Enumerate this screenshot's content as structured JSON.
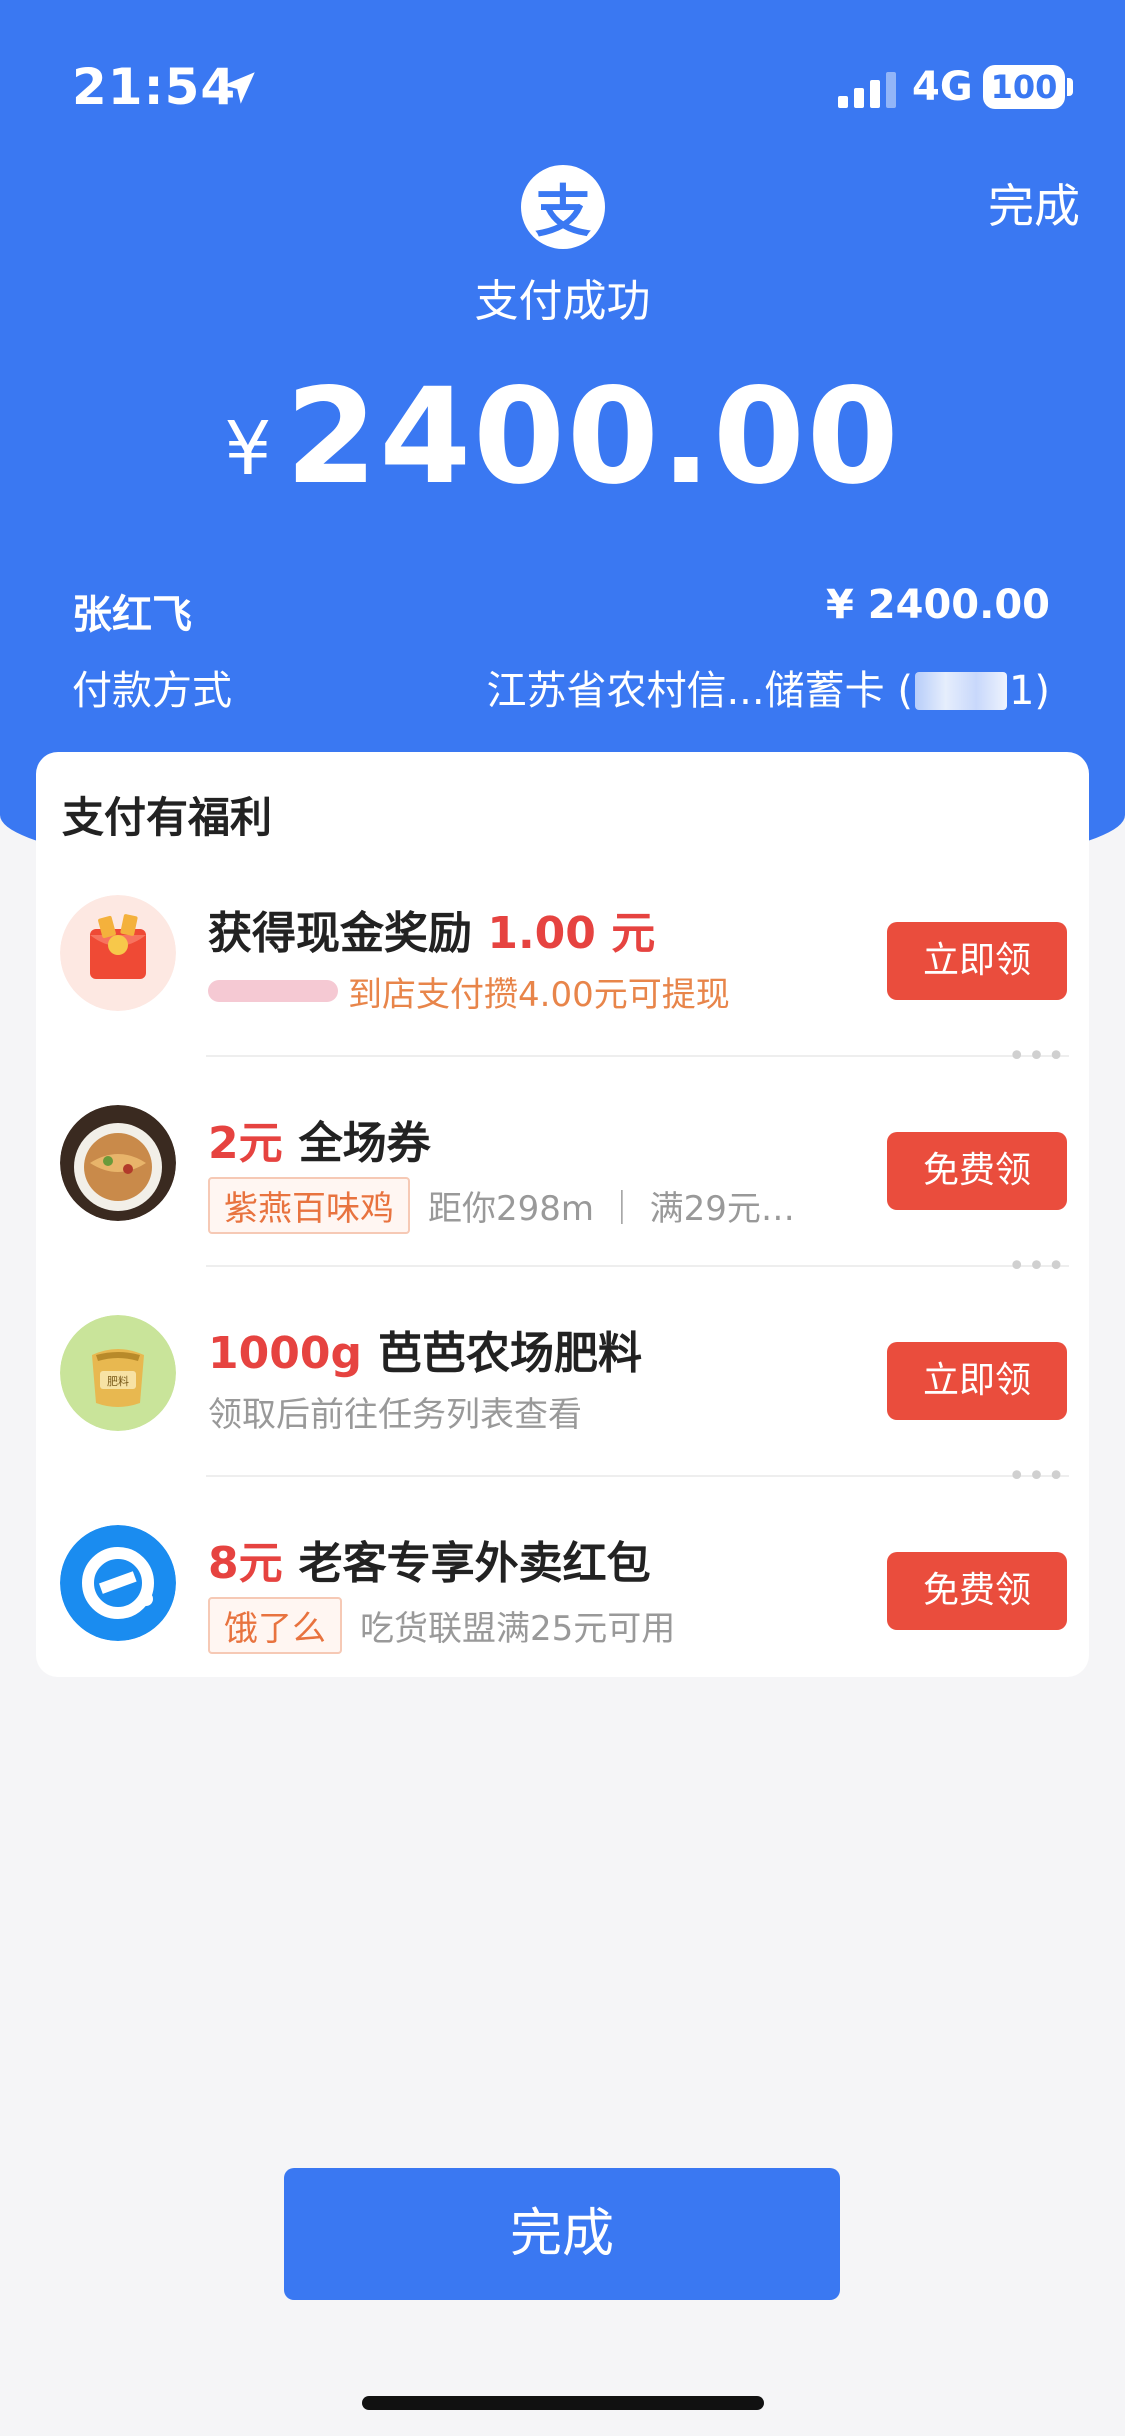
{
  "status_bar": {
    "time": "21:54",
    "network": "4G",
    "battery": "100"
  },
  "header": {
    "done_label": "完成",
    "logo_char": "支",
    "success_text": "支付成功",
    "currency": "¥",
    "amount": "2400.00"
  },
  "details": {
    "payee": "张红飞",
    "payee_amount": "¥ 2400.00",
    "method_label": "付款方式",
    "method_value_prefix": "江苏省农村信...储蓄卡 (",
    "method_value_suffix": "1)"
  },
  "benefits": {
    "title": "支付有福利",
    "items": [
      {
        "title_prefix": "获得现金奖励",
        "title_highlight": "1.00",
        "title_suffix": "元",
        "subtitle": "到店支付攒4.00元可提现",
        "cta": "立即领"
      },
      {
        "title_highlight": "2元",
        "title": "全场券",
        "tag": "紫燕百味鸡",
        "subtitle": "距你298m ｜ 满29元…",
        "cta": "免费领"
      },
      {
        "title_highlight": "1000g",
        "title": "芭芭农场肥料",
        "subtitle": "领取后前往任务列表查看",
        "cta": "立即领"
      },
      {
        "title_highlight": "8元",
        "title": "老客专享外卖红包",
        "tag": "饿了么",
        "subtitle": "吃货联盟满25元可用",
        "cta": "免费领"
      }
    ]
  },
  "footer": {
    "done_label": "完成"
  },
  "colors": {
    "brand_blue": "#3a78f2",
    "cta_red": "#ea4d3d",
    "highlight_red": "#e64340"
  }
}
